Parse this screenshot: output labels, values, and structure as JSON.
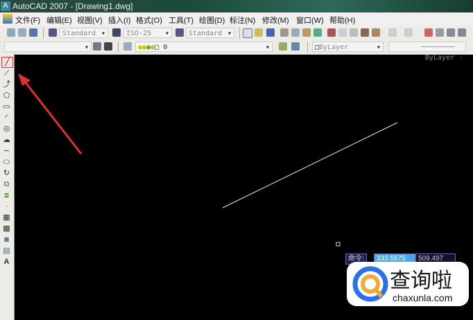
{
  "title": "AutoCAD 2007 - [Drawing1.dwg]",
  "menu": [
    "文件(F)",
    "编辑(E)",
    "视图(V)",
    "插入(I)",
    "格式(O)",
    "工具(T)",
    "绘图(D)",
    "标注(N)",
    "修改(M)",
    "窗口(W)",
    "帮助(H)"
  ],
  "toolbar": {
    "text_style": "Standard",
    "dim_style": "ISO-25",
    "table_style": "Standard",
    "layer": "0",
    "color": "ByLayer",
    "linetype": "ByLayer"
  },
  "draw_tools": [
    "line",
    "construction-line",
    "polyline",
    "polygon",
    "rectangle",
    "arc",
    "circle",
    "revision-cloud",
    "spline",
    "ellipse",
    "ellipse-arc",
    "insert-block",
    "make-block",
    "point",
    "hatch",
    "gradient",
    "region",
    "table",
    "multiline-text"
  ],
  "text_tool_label": "A",
  "command": {
    "prompt": "命令:",
    "x": "333.5575",
    "y": "509.497"
  },
  "watermark": {
    "brand": "查询啦",
    "url": "chaxunla.com"
  },
  "colors": {
    "accent": "#e03030",
    "line": "#e8e8e8"
  }
}
